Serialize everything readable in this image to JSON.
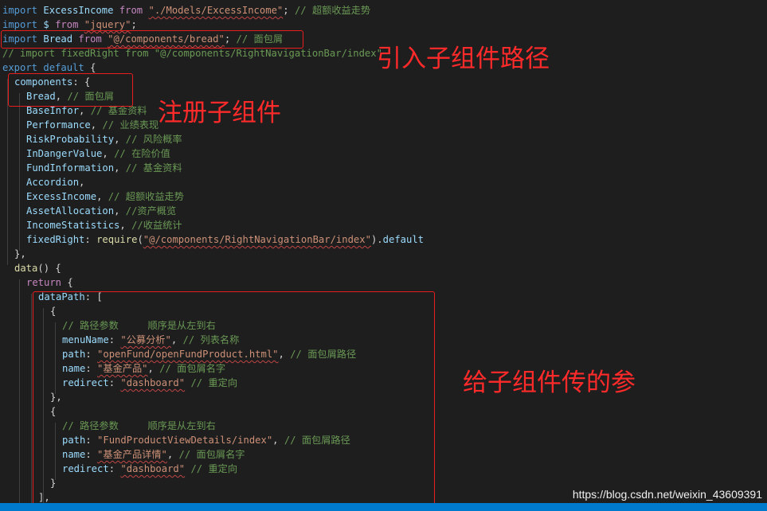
{
  "code_lines": [
    {
      "indent": 0,
      "tokens": [
        {
          "t": "k",
          "v": "import"
        },
        {
          "t": "p",
          "v": " "
        },
        {
          "t": "v",
          "v": "ExcessIncome"
        },
        {
          "t": "p",
          "v": " "
        },
        {
          "t": "kp",
          "v": "from"
        },
        {
          "t": "p",
          "v": " "
        },
        {
          "t": "s",
          "v": "\"./Models/ExcessIncome\""
        },
        {
          "t": "p",
          "v": "; "
        },
        {
          "t": "c",
          "v": "// 超额收益走势"
        }
      ]
    },
    {
      "indent": 0,
      "tokens": [
        {
          "t": "k",
          "v": "import"
        },
        {
          "t": "p",
          "v": " "
        },
        {
          "t": "v",
          "v": "$"
        },
        {
          "t": "p",
          "v": " "
        },
        {
          "t": "kp",
          "v": "from"
        },
        {
          "t": "p",
          "v": " "
        },
        {
          "t": "s",
          "v": "\"jquery\""
        },
        {
          "t": "p",
          "v": ";"
        }
      ]
    },
    {
      "indent": 0,
      "tokens": [
        {
          "t": "k",
          "v": "import"
        },
        {
          "t": "p",
          "v": " "
        },
        {
          "t": "v",
          "v": "Bread"
        },
        {
          "t": "p",
          "v": " "
        },
        {
          "t": "kp",
          "v": "from"
        },
        {
          "t": "p",
          "v": " "
        },
        {
          "t": "s",
          "v": "\"@/components/bread\""
        },
        {
          "t": "p",
          "v": "; "
        },
        {
          "t": "c",
          "v": "// 面包屑"
        }
      ]
    },
    {
      "indent": 0,
      "tokens": [
        {
          "t": "c",
          "v": "// import fixedRight from \"@/components/RightNavigationBar/index\""
        }
      ]
    },
    {
      "indent": 0,
      "tokens": [
        {
          "t": "k",
          "v": "export"
        },
        {
          "t": "p",
          "v": " "
        },
        {
          "t": "k",
          "v": "default"
        },
        {
          "t": "p",
          "v": " {"
        }
      ]
    },
    {
      "indent": 1,
      "tokens": [
        {
          "t": "v",
          "v": "components"
        },
        {
          "t": "p",
          "v": ": {"
        }
      ]
    },
    {
      "indent": 2,
      "tokens": [
        {
          "t": "v",
          "v": "Bread"
        },
        {
          "t": "p",
          "v": ", "
        },
        {
          "t": "c",
          "v": "// 面包屑"
        }
      ]
    },
    {
      "indent": 2,
      "tokens": [
        {
          "t": "v",
          "v": "BaseInfor"
        },
        {
          "t": "p",
          "v": ", "
        },
        {
          "t": "c",
          "v": "// 基金资料"
        }
      ]
    },
    {
      "indent": 2,
      "tokens": [
        {
          "t": "v",
          "v": "Performance"
        },
        {
          "t": "p",
          "v": ", "
        },
        {
          "t": "c",
          "v": "// 业绩表现"
        }
      ]
    },
    {
      "indent": 2,
      "tokens": [
        {
          "t": "v",
          "v": "RiskProbability"
        },
        {
          "t": "p",
          "v": ", "
        },
        {
          "t": "c",
          "v": "// 风险概率"
        }
      ]
    },
    {
      "indent": 2,
      "tokens": [
        {
          "t": "v",
          "v": "InDangerValue"
        },
        {
          "t": "p",
          "v": ", "
        },
        {
          "t": "c",
          "v": "// 在险价值"
        }
      ]
    },
    {
      "indent": 2,
      "tokens": [
        {
          "t": "v",
          "v": "FundInformation"
        },
        {
          "t": "p",
          "v": ", "
        },
        {
          "t": "c",
          "v": "// 基金资料"
        }
      ]
    },
    {
      "indent": 2,
      "tokens": [
        {
          "t": "v",
          "v": "Accordion"
        },
        {
          "t": "p",
          "v": ","
        }
      ]
    },
    {
      "indent": 2,
      "tokens": [
        {
          "t": "v",
          "v": "ExcessIncome"
        },
        {
          "t": "p",
          "v": ", "
        },
        {
          "t": "c",
          "v": "// 超额收益走势"
        }
      ]
    },
    {
      "indent": 2,
      "tokens": [
        {
          "t": "v",
          "v": "AssetAllocation"
        },
        {
          "t": "p",
          "v": ", "
        },
        {
          "t": "c",
          "v": "//资产概览"
        }
      ]
    },
    {
      "indent": 2,
      "tokens": [
        {
          "t": "v",
          "v": "IncomeStatistics"
        },
        {
          "t": "p",
          "v": ", "
        },
        {
          "t": "c",
          "v": "//收益统计"
        }
      ]
    },
    {
      "indent": 2,
      "tokens": [
        {
          "t": "v",
          "v": "fixedRight"
        },
        {
          "t": "p",
          "v": ": "
        },
        {
          "t": "f",
          "v": "require"
        },
        {
          "t": "p",
          "v": "("
        },
        {
          "t": "s",
          "v": "\"@/components/RightNavigationBar/index\""
        },
        {
          "t": "p",
          "v": ")."
        },
        {
          "t": "v",
          "v": "default"
        }
      ]
    },
    {
      "indent": 1,
      "tokens": [
        {
          "t": "p",
          "v": "},"
        }
      ]
    },
    {
      "indent": 1,
      "tokens": [
        {
          "t": "f",
          "v": "data"
        },
        {
          "t": "p",
          "v": "() {"
        }
      ]
    },
    {
      "indent": 2,
      "tokens": [
        {
          "t": "kp",
          "v": "return"
        },
        {
          "t": "p",
          "v": " {"
        }
      ]
    },
    {
      "indent": 3,
      "tokens": [
        {
          "t": "v",
          "v": "dataPath"
        },
        {
          "t": "p",
          "v": ": ["
        }
      ]
    },
    {
      "indent": 4,
      "tokens": [
        {
          "t": "p",
          "v": "{"
        }
      ]
    },
    {
      "indent": 5,
      "tokens": [
        {
          "t": "c",
          "v": "// 路径参数     顺序是从左到右"
        }
      ]
    },
    {
      "indent": 5,
      "tokens": [
        {
          "t": "v",
          "v": "menuName"
        },
        {
          "t": "p",
          "v": ": "
        },
        {
          "t": "s",
          "v": "\"公募分析\""
        },
        {
          "t": "p",
          "v": ", "
        },
        {
          "t": "c",
          "v": "// 列表名称"
        }
      ]
    },
    {
      "indent": 5,
      "tokens": [
        {
          "t": "v",
          "v": "path"
        },
        {
          "t": "p",
          "v": ": "
        },
        {
          "t": "s",
          "v": "\"openFund/openFundProduct.html\""
        },
        {
          "t": "p",
          "v": ", "
        },
        {
          "t": "c",
          "v": "// 面包屑路径"
        }
      ]
    },
    {
      "indent": 5,
      "tokens": [
        {
          "t": "v",
          "v": "name"
        },
        {
          "t": "p",
          "v": ": "
        },
        {
          "t": "s",
          "v": "\"基金产品\""
        },
        {
          "t": "p",
          "v": ", "
        },
        {
          "t": "c",
          "v": "// 面包屑名字"
        }
      ]
    },
    {
      "indent": 5,
      "tokens": [
        {
          "t": "v",
          "v": "redirect"
        },
        {
          "t": "p",
          "v": ": "
        },
        {
          "t": "s",
          "v": "\"dashboard\""
        },
        {
          "t": "p",
          "v": " "
        },
        {
          "t": "c",
          "v": "// 重定向"
        }
      ]
    },
    {
      "indent": 4,
      "tokens": [
        {
          "t": "p",
          "v": "},"
        }
      ]
    },
    {
      "indent": 4,
      "tokens": [
        {
          "t": "p",
          "v": "{"
        }
      ]
    },
    {
      "indent": 5,
      "tokens": [
        {
          "t": "c",
          "v": "// 路径参数     顺序是从左到右"
        }
      ]
    },
    {
      "indent": 5,
      "tokens": [
        {
          "t": "v",
          "v": "path"
        },
        {
          "t": "p",
          "v": ": "
        },
        {
          "t": "s2",
          "v": "\"FundProductViewDetails/index\""
        },
        {
          "t": "p",
          "v": ", "
        },
        {
          "t": "c",
          "v": "// 面包屑路径"
        }
      ]
    },
    {
      "indent": 5,
      "tokens": [
        {
          "t": "v",
          "v": "name"
        },
        {
          "t": "p",
          "v": ": "
        },
        {
          "t": "s",
          "v": "\"基金产品详情\""
        },
        {
          "t": "p",
          "v": ", "
        },
        {
          "t": "c",
          "v": "// 面包屑名字"
        }
      ]
    },
    {
      "indent": 5,
      "tokens": [
        {
          "t": "v",
          "v": "redirect"
        },
        {
          "t": "p",
          "v": ": "
        },
        {
          "t": "s",
          "v": "\"dashboard\""
        },
        {
          "t": "p",
          "v": " "
        },
        {
          "t": "c",
          "v": "// 重定向"
        }
      ]
    },
    {
      "indent": 4,
      "tokens": [
        {
          "t": "p",
          "v": "}"
        }
      ]
    },
    {
      "indent": 3,
      "tokens": [
        {
          "t": "p",
          "v": "],"
        }
      ]
    }
  ],
  "annotations": {
    "import_path": "引入子组件路径",
    "register": "注册子组件",
    "props_passed": "给子组件传的参"
  },
  "watermark": "https://blog.csdn.net/weixin_43609391",
  "colors": {
    "background": "#1e1e1e",
    "keyword": "#569cd6",
    "control_keyword": "#c586c0",
    "variable": "#9cdcfe",
    "string": "#ce9178",
    "comment": "#6a9955",
    "function": "#dcdcaa",
    "annotation_red": "#ff2a2a",
    "status_bar": "#007acc"
  }
}
